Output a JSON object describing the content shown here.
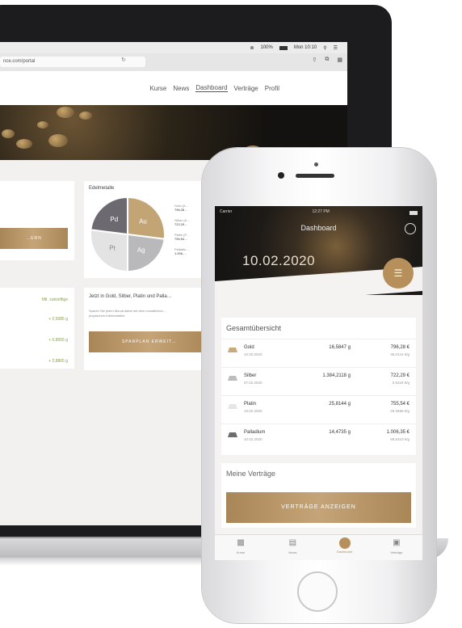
{
  "laptop": {
    "menubar": {
      "wifi": "⋒",
      "battery_pct": "100%",
      "time": "Mon 10:10"
    },
    "url": "nce.com/portal",
    "nav": {
      "items": [
        "Kurse",
        "News",
        "Dashboard",
        "Verträge",
        "Profil"
      ],
      "active_index": 2
    },
    "edelmetalle_title": "Edelmetalle",
    "pie": {
      "slices": [
        {
          "label": "Au",
          "value": 27,
          "color": "#c3a474"
        },
        {
          "label": "Ag",
          "value": 23,
          "color": "#b9b9bb"
        },
        {
          "label": "Pt",
          "value": 27,
          "color": "#e3e3e4"
        },
        {
          "label": "Pd",
          "value": 23,
          "color": "#6c6a70"
        }
      ],
      "legend": [
        {
          "label": "Gold (A…",
          "value": "796,28…"
        },
        {
          "label": "Silber (A…",
          "value": "722,29…"
        },
        {
          "label": "Platin (P…",
          "value": "755,54…"
        },
        {
          "label": "Palladiu…",
          "value": "1.006,…"
        }
      ]
    },
    "invest_title": "Jetzt in Gold, Silber, Platin und Palla…",
    "invest_text1": "Sparen Sie jeden Monat dabei mit dem monatlichen…",
    "invest_text2": "physischen Edelmetallen.",
    "invest_button": "SPARPLAN ERWEIT…",
    "left_button": "…ERN",
    "left_list_header": "Mtl. zukünftige",
    "left_list_values": [
      "+ 2,5085 g",
      "+ 0,8055 g",
      "+ 2,8865 g"
    ]
  },
  "app": {
    "status": {
      "carrier": "Carrier",
      "time": "12:27 PM"
    },
    "title": "Dashboard",
    "date": "10.02.2020",
    "overview": {
      "title": "Gesamtübersicht",
      "rows": [
        {
          "name": "Gold",
          "date": "10.02.2020",
          "amount": "16,5847 g",
          "value": "796,28 €",
          "sub": "48,0141 €/g"
        },
        {
          "name": "Silber",
          "date": "07.02.2020",
          "amount": "1.384,2118 g",
          "value": "722,29 €",
          "sub": "0,5218 €/g"
        },
        {
          "name": "Platin",
          "date": "10.02.2020",
          "amount": "25,8144 g",
          "value": "755,54 €",
          "sub": "29,2686 €/g"
        },
        {
          "name": "Palladium",
          "date": "10.02.2020",
          "amount": "14,4735 g",
          "value": "1.006,35 €",
          "sub": "69,5310 €/g"
        }
      ]
    },
    "contracts": {
      "title": "Meine Verträge",
      "button": "VERTRÄGE ANZEIGEN"
    },
    "tabs": [
      {
        "label": "Kurse",
        "icon": "chart-icon"
      },
      {
        "label": "News",
        "icon": "news-icon"
      },
      {
        "label": "Dashboard",
        "icon": "dashboard-icon"
      },
      {
        "label": "Verträge",
        "icon": "contracts-icon"
      }
    ]
  },
  "colors": {
    "gold": "#b68f5a",
    "dark": "#1d1a17",
    "green": "#8aa43a"
  }
}
